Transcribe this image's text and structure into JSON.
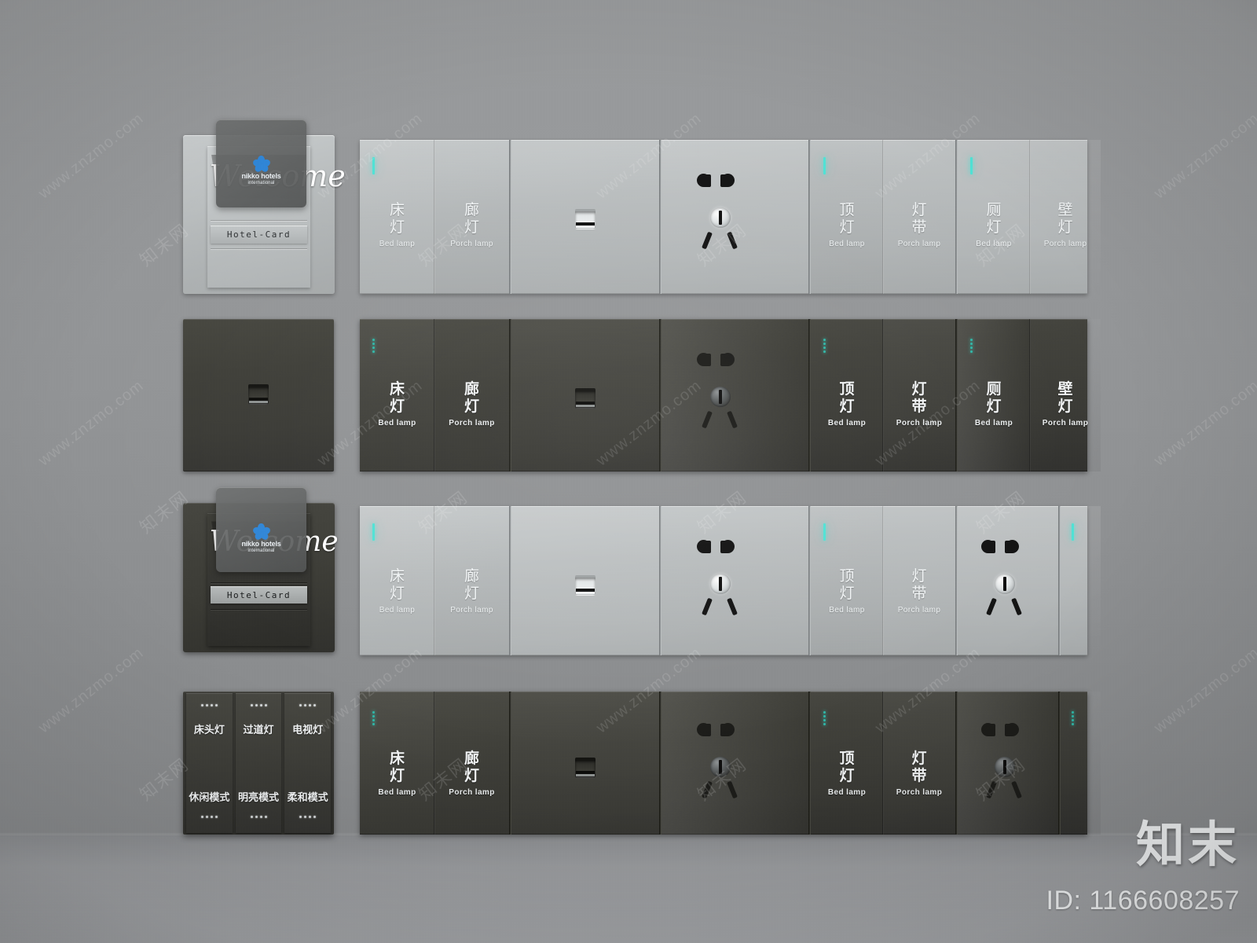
{
  "meta": {
    "brandmark": "知末",
    "id_text": "ID: 1166608257",
    "watermark_latin": "www.znzmo.com",
    "watermark_cn": "知末网",
    "accent_led": "#4fe3d6",
    "led_dot": "#2fb9a9",
    "plate_light": "#b9bdbe",
    "plate_dark": "#3b3b35",
    "background": "#8e9092",
    "card_logo_blue": "#2f86d8"
  },
  "card_reader": {
    "welcome_text": "Welcome",
    "strip_label": "Hotel-Card",
    "card_brand_line1": "nikko hotels",
    "card_brand_line2": "international",
    "icon": "five-petal-flower-icon"
  },
  "labels": {
    "bed": {
      "cn": "床\n灯",
      "cn1": "床",
      "cn2": "灯",
      "en": "Bed lamp"
    },
    "porch": {
      "cn1": "廊",
      "cn2": "灯",
      "en": "Porch lamp"
    },
    "ceiling": {
      "cn1": "顶",
      "cn2": "灯",
      "en": "Bed lamp"
    },
    "strip": {
      "cn1": "灯",
      "cn2": "带",
      "en": "Porch lamp"
    },
    "toilet": {
      "cn1": "厕",
      "cn2": "灯",
      "en": "Bed lamp"
    },
    "wall": {
      "cn1": "壁",
      "cn2": "灯",
      "en": "Porch lamp"
    }
  },
  "rows": [
    {
      "name": "row-1-light",
      "finish": "light",
      "accessory": "card-reader-light",
      "keys": [
        {
          "type": "switch",
          "cn1": "床",
          "cn2": "灯",
          "en": "Bed lamp",
          "led": "bar"
        },
        {
          "type": "switch",
          "cn1": "廊",
          "cn2": "灯",
          "en": "Porch lamp",
          "led": "none"
        },
        {
          "type": "jack",
          "icon": "rj45-jack-icon"
        },
        {
          "type": "socket",
          "icon": "five-hole-socket-icon"
        },
        {
          "type": "switch",
          "cn1": "顶",
          "cn2": "灯",
          "en": "Bed lamp",
          "led": "bar"
        },
        {
          "type": "switch",
          "cn1": "灯",
          "cn2": "带",
          "en": "Porch lamp",
          "led": "none"
        },
        {
          "type": "switch",
          "cn1": "厕",
          "cn2": "灯",
          "en": "Bed lamp",
          "led": "bar"
        },
        {
          "type": "switch",
          "cn1": "壁",
          "cn2": "灯",
          "en": "Porch lamp",
          "led": "none"
        }
      ]
    },
    {
      "name": "row-2-dark",
      "finish": "dark",
      "accessory": "data-jack-dark",
      "keys": [
        {
          "type": "switch",
          "cn1": "床",
          "cn2": "灯",
          "en": "Bed lamp",
          "led": "dots"
        },
        {
          "type": "switch",
          "cn1": "廊",
          "cn2": "灯",
          "en": "Porch lamp",
          "led": "none"
        },
        {
          "type": "jack",
          "icon": "rj45-jack-icon"
        },
        {
          "type": "socket",
          "icon": "five-hole-socket-icon"
        },
        {
          "type": "switch",
          "cn1": "顶",
          "cn2": "灯",
          "en": "Bed lamp",
          "led": "dots"
        },
        {
          "type": "switch",
          "cn1": "灯",
          "cn2": "带",
          "en": "Porch lamp",
          "led": "none"
        },
        {
          "type": "switch",
          "cn1": "厕",
          "cn2": "灯",
          "en": "Bed lamp",
          "led": "dots"
        },
        {
          "type": "switch",
          "cn1": "壁",
          "cn2": "灯",
          "en": "Porch lamp",
          "led": "none"
        }
      ]
    },
    {
      "name": "row-3-light",
      "finish": "light",
      "accessory": "card-reader-dark",
      "keys": [
        {
          "type": "switch",
          "cn1": "床",
          "cn2": "灯",
          "en": "Bed lamp",
          "led": "bar"
        },
        {
          "type": "switch",
          "cn1": "廊",
          "cn2": "灯",
          "en": "Porch lamp",
          "led": "none"
        },
        {
          "type": "jack",
          "icon": "rj45-jack-icon"
        },
        {
          "type": "socket",
          "icon": "five-hole-socket-icon"
        },
        {
          "type": "switch",
          "cn1": "顶",
          "cn2": "灯",
          "en": "Bed lamp",
          "led": "bar"
        },
        {
          "type": "switch",
          "cn1": "灯",
          "cn2": "带",
          "en": "Porch lamp",
          "led": "none"
        },
        {
          "type": "socket",
          "icon": "five-hole-socket-icon"
        },
        {
          "type": "blank",
          "led": "bar"
        }
      ]
    },
    {
      "name": "row-4-dark",
      "finish": "dark",
      "accessory": "scene-panel",
      "keys": [
        {
          "type": "switch",
          "cn1": "床",
          "cn2": "灯",
          "en": "Bed lamp",
          "led": "dots"
        },
        {
          "type": "switch",
          "cn1": "廊",
          "cn2": "灯",
          "en": "Porch lamp",
          "led": "none"
        },
        {
          "type": "jack",
          "icon": "rj45-jack-icon"
        },
        {
          "type": "socket",
          "icon": "five-hole-socket-icon"
        },
        {
          "type": "switch",
          "cn1": "顶",
          "cn2": "灯",
          "en": "Bed lamp",
          "led": "dots"
        },
        {
          "type": "switch",
          "cn1": "灯",
          "cn2": "带",
          "en": "Porch lamp",
          "led": "none"
        },
        {
          "type": "socket",
          "icon": "five-hole-socket-icon"
        },
        {
          "type": "blank",
          "led": "dots"
        }
      ]
    }
  ],
  "scene_panel": {
    "buttons": [
      {
        "top_label": "床头灯",
        "bottom_label": "休闲模式",
        "top_dots": 4,
        "bottom_dots": 4
      },
      {
        "top_label": "过道灯",
        "bottom_label": "明亮模式",
        "top_dots": 4,
        "bottom_dots": 4
      },
      {
        "top_label": "电视灯",
        "bottom_label": "柔和模式",
        "top_dots": 4,
        "bottom_dots": 4
      }
    ]
  }
}
